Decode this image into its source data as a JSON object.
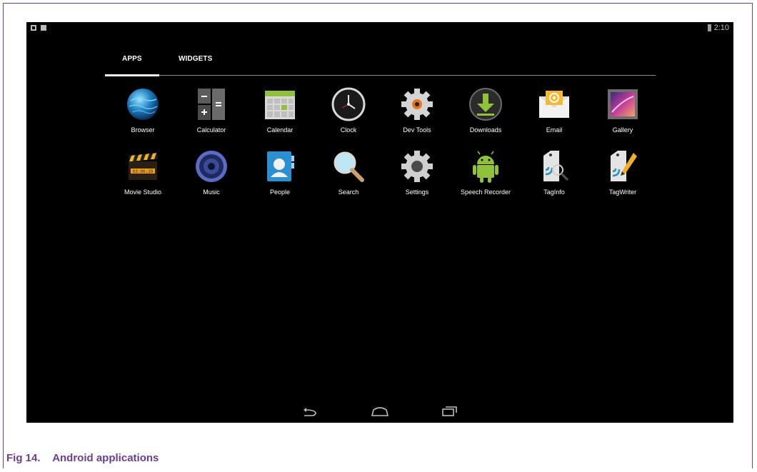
{
  "status_bar": {
    "time": "2:10"
  },
  "tabs": [
    {
      "label": "APPS",
      "selected": true
    },
    {
      "label": "WIDGETS",
      "selected": false
    }
  ],
  "apps": [
    {
      "label": "Browser",
      "icon": "browser-icon"
    },
    {
      "label": "Calculator",
      "icon": "calculator-icon"
    },
    {
      "label": "Calendar",
      "icon": "calendar-icon"
    },
    {
      "label": "Clock",
      "icon": "clock-icon"
    },
    {
      "label": "Dev Tools",
      "icon": "dev-tools-icon"
    },
    {
      "label": "Downloads",
      "icon": "downloads-icon"
    },
    {
      "label": "Email",
      "icon": "email-icon"
    },
    {
      "label": "Gallery",
      "icon": "gallery-icon"
    },
    {
      "label": "Movie Studio",
      "icon": "movie-studio-icon"
    },
    {
      "label": "Music",
      "icon": "music-icon"
    },
    {
      "label": "People",
      "icon": "people-icon"
    },
    {
      "label": "Search",
      "icon": "search-icon"
    },
    {
      "label": "Settings",
      "icon": "settings-icon"
    },
    {
      "label": "Speech Recorder",
      "icon": "speech-recorder-icon"
    },
    {
      "label": "TagInfo",
      "icon": "taginfo-icon"
    },
    {
      "label": "TagWriter",
      "icon": "tagwriter-icon"
    }
  ],
  "navigation": {
    "buttons": [
      "back-icon",
      "home-icon",
      "recents-icon"
    ]
  },
  "caption": {
    "figure": "Fig 14.",
    "title": "Android applications"
  }
}
